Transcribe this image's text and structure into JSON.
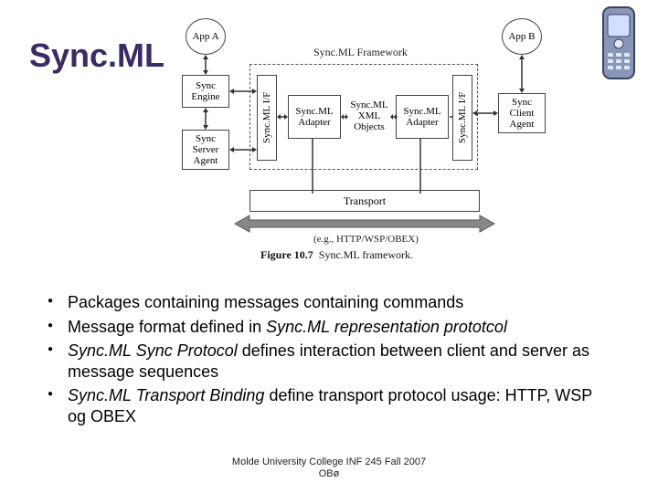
{
  "title": "Sync.ML",
  "phone_icon": "mobile-phone-icon",
  "diagram": {
    "frame_label": "Sync.ML Framework",
    "left": {
      "app": "App A",
      "engine": "Sync\nEngine",
      "agent": "Sync\nServer\nAgent"
    },
    "right": {
      "app": "App B",
      "agent": "Sync\nClient\nAgent"
    },
    "inside": {
      "if_left": "Sync.ML I/F",
      "adapter_left": "Sync.ML\nAdapter",
      "xml": "Sync.ML\nXML\nObjects",
      "adapter_right": "Sync.ML\nAdapter",
      "if_right": "Sync.ML I/F"
    },
    "transport": "Transport",
    "under_transport": "(e.g., HTTP/WSP/OBEX)",
    "caption_bold": "Figure 10.7",
    "caption_rest": "Sync.ML framework."
  },
  "bullets": [
    {
      "plain": "Packages containing messages containing commands"
    },
    {
      "plain_before": "Message format defined in ",
      "italic": "Sync.ML representation prototcol",
      "plain_after": ""
    },
    {
      "italic_first": "Sync.ML Sync Protocol",
      "plain_after": " defines interaction between client and server as message sequences"
    },
    {
      "italic_first": "Sync.ML Transport Binding",
      "plain_after": " define transport protocol usage: HTTP, WSP og OBEX"
    }
  ],
  "footer_line1": "Molde University College INF 245 Fall 2007",
  "footer_line2": "OBø"
}
